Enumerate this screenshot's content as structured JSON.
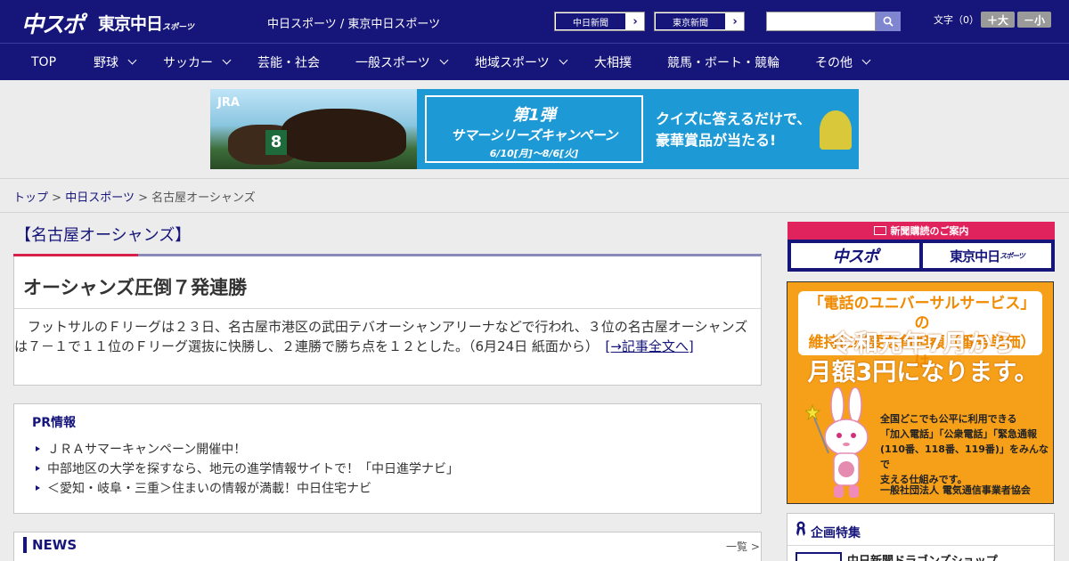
{
  "header": {
    "logo_chuspo": "中スポ",
    "logo_tokyo": "東京中日",
    "logo_tokyo_suffix": "スポーツ",
    "site_name": "中日スポーツ / 東京中日スポーツ",
    "ext_links": [
      {
        "label": "中日新聞"
      },
      {
        "label": "東京新聞"
      }
    ],
    "search": {
      "value": "",
      "placeholder": ""
    },
    "fontsize_label": "文字（0）",
    "fontsize_large": "＋大",
    "fontsize_small": "－小"
  },
  "nav": {
    "items": [
      {
        "label": "TOP",
        "dropdown": false
      },
      {
        "label": "野球",
        "dropdown": true
      },
      {
        "label": "サッカー",
        "dropdown": true
      },
      {
        "label": "芸能・社会",
        "dropdown": false
      },
      {
        "label": "一般スポーツ",
        "dropdown": true
      },
      {
        "label": "地域スポーツ",
        "dropdown": true
      },
      {
        "label": "大相撲",
        "dropdown": false
      },
      {
        "label": "競馬・ボート・競輪",
        "dropdown": false
      },
      {
        "label": "その他",
        "dropdown": true
      }
    ]
  },
  "ad_banner": {
    "brand": "JRA",
    "number": "8",
    "headline_1": "第1弾",
    "headline_2": "サマーシリーズキャンペーン",
    "dates": "6/10[月]～8/6[火]",
    "copy_1": "クイズに答えるだけで、",
    "copy_2": "豪華賞品が当たる!"
  },
  "breadcrumb": {
    "home": "トップ",
    "section": "中日スポーツ",
    "current": "名古屋オーシャンズ",
    "sep": ">"
  },
  "section_title": "【名古屋オーシャンズ】",
  "article": {
    "headline": "オーシャンズ圧倒７発連勝",
    "body": "フットサルのＦリーグは２３日、名古屋市港区の武田テバオーシャンアリーナなどで行われ、３位の名古屋オーシャンズは７－１で１１位のＦリーグ選抜に快勝し、２連勝で勝ち点を１２とした。（6月24日 紙面から）",
    "more_link": "[→記事全文へ]"
  },
  "pr": {
    "title": "PR情報",
    "items": [
      "ＪＲＡサマーキャンペーン開催中！",
      "中部地区の大学を探すなら、地元の進学情報サイトで！「中日進学ナビ」",
      "＜愛知・岐阜・三重＞住まいの情報が満載！中日住宅ナビ"
    ]
  },
  "news": {
    "title": "NEWS",
    "more": "一覧 >"
  },
  "subscription": {
    "head": "新聞購読のご案内",
    "btn_chuspo": "中スポ",
    "btn_tokyo": "東京中日",
    "btn_tokyo_suffix": "スポーツ"
  },
  "universal_ad": {
    "top_line_1": "「電話のユニバーサルサービス」の",
    "top_line_2": "維持に必要な負担額（番号単価）は",
    "big_line_1": "令和元年7月から",
    "big_line_2": "月額3円になります。",
    "body_1": "全国どこでも公平に利用できる",
    "body_2": "「加入電話」「公衆電話」「緊急通報",
    "body_3": "(110番、118番、119番)」をみんなで",
    "body_4": "支える仕組みです。",
    "org": "一般社団法人 電気通信事業者協会"
  },
  "feature": {
    "title": "企画特集",
    "first_item": "中日新聞ドラゴンズショップ"
  },
  "colors": {
    "brand_navy": "#15157a",
    "accent_red": "#d6224a",
    "ad_orange": "#f6a01a"
  }
}
